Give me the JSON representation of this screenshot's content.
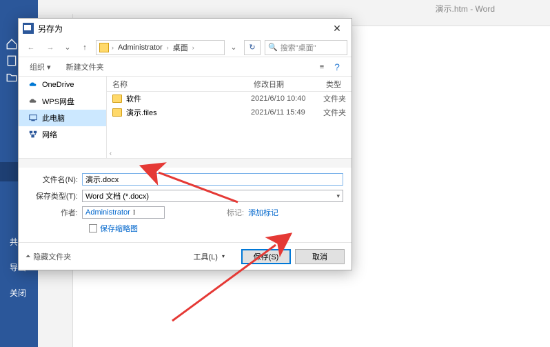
{
  "word": {
    "title": "演示.htm - Word"
  },
  "blue_side": {
    "share": "共享",
    "export": "导出",
    "close": "关闭"
  },
  "dialog": {
    "title": "另存为",
    "close": "✕",
    "nav": {
      "back": "←",
      "fwd": "→",
      "up": "↑",
      "crumb1": "Administrator",
      "crumb2": "桌面",
      "dropdown": "⌄",
      "refresh": "↻",
      "search_placeholder": "搜索\"桌面\""
    },
    "toolbar": {
      "organize": "组织 ▾",
      "newfolder": "新建文件夹",
      "view": "≡",
      "help": "?"
    },
    "side": {
      "onedrive": "OneDrive",
      "wps": "WPS网盘",
      "thispc": "此电脑",
      "network": "网络"
    },
    "files": {
      "hdr_name": "名称",
      "hdr_date": "修改日期",
      "hdr_type": "类型",
      "rows": [
        {
          "name": "软件",
          "date": "2021/6/10 10:40",
          "type": "文件夹"
        },
        {
          "name": "演示.files",
          "date": "2021/6/11 15:49",
          "type": "文件夹"
        }
      ]
    },
    "fields": {
      "filename_label": "文件名(N):",
      "filename_value": "演示.docx",
      "filetype_label": "保存类型(T):",
      "filetype_value": "Word 文档 (*.docx)",
      "author_label": "作者:",
      "author_value": "Administrator",
      "tags_label": "标记:",
      "tags_link": "添加标记",
      "thumbnail": "保存缩略图"
    },
    "footer": {
      "hide": "隐藏文件夹",
      "tools": "工具(L)",
      "save": "保存(S)",
      "cancel": "取消"
    }
  }
}
